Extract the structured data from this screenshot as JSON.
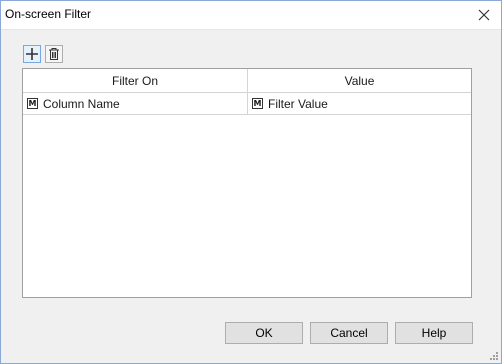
{
  "window": {
    "title": "On-screen Filter"
  },
  "toolbar": {
    "add_icon": "plus-icon",
    "delete_icon": "trash-icon"
  },
  "grid": {
    "columns": [
      "Filter On",
      "Value"
    ],
    "rows": [
      {
        "filter_on": "Column Name",
        "value": "Filter Value",
        "badge": "M"
      }
    ]
  },
  "buttons": {
    "ok": "OK",
    "cancel": "Cancel",
    "help": "Help"
  },
  "colors": {
    "accent": "#0078d7",
    "border": "#8aa9d6",
    "dialog_bg": "#f0f0f0"
  }
}
